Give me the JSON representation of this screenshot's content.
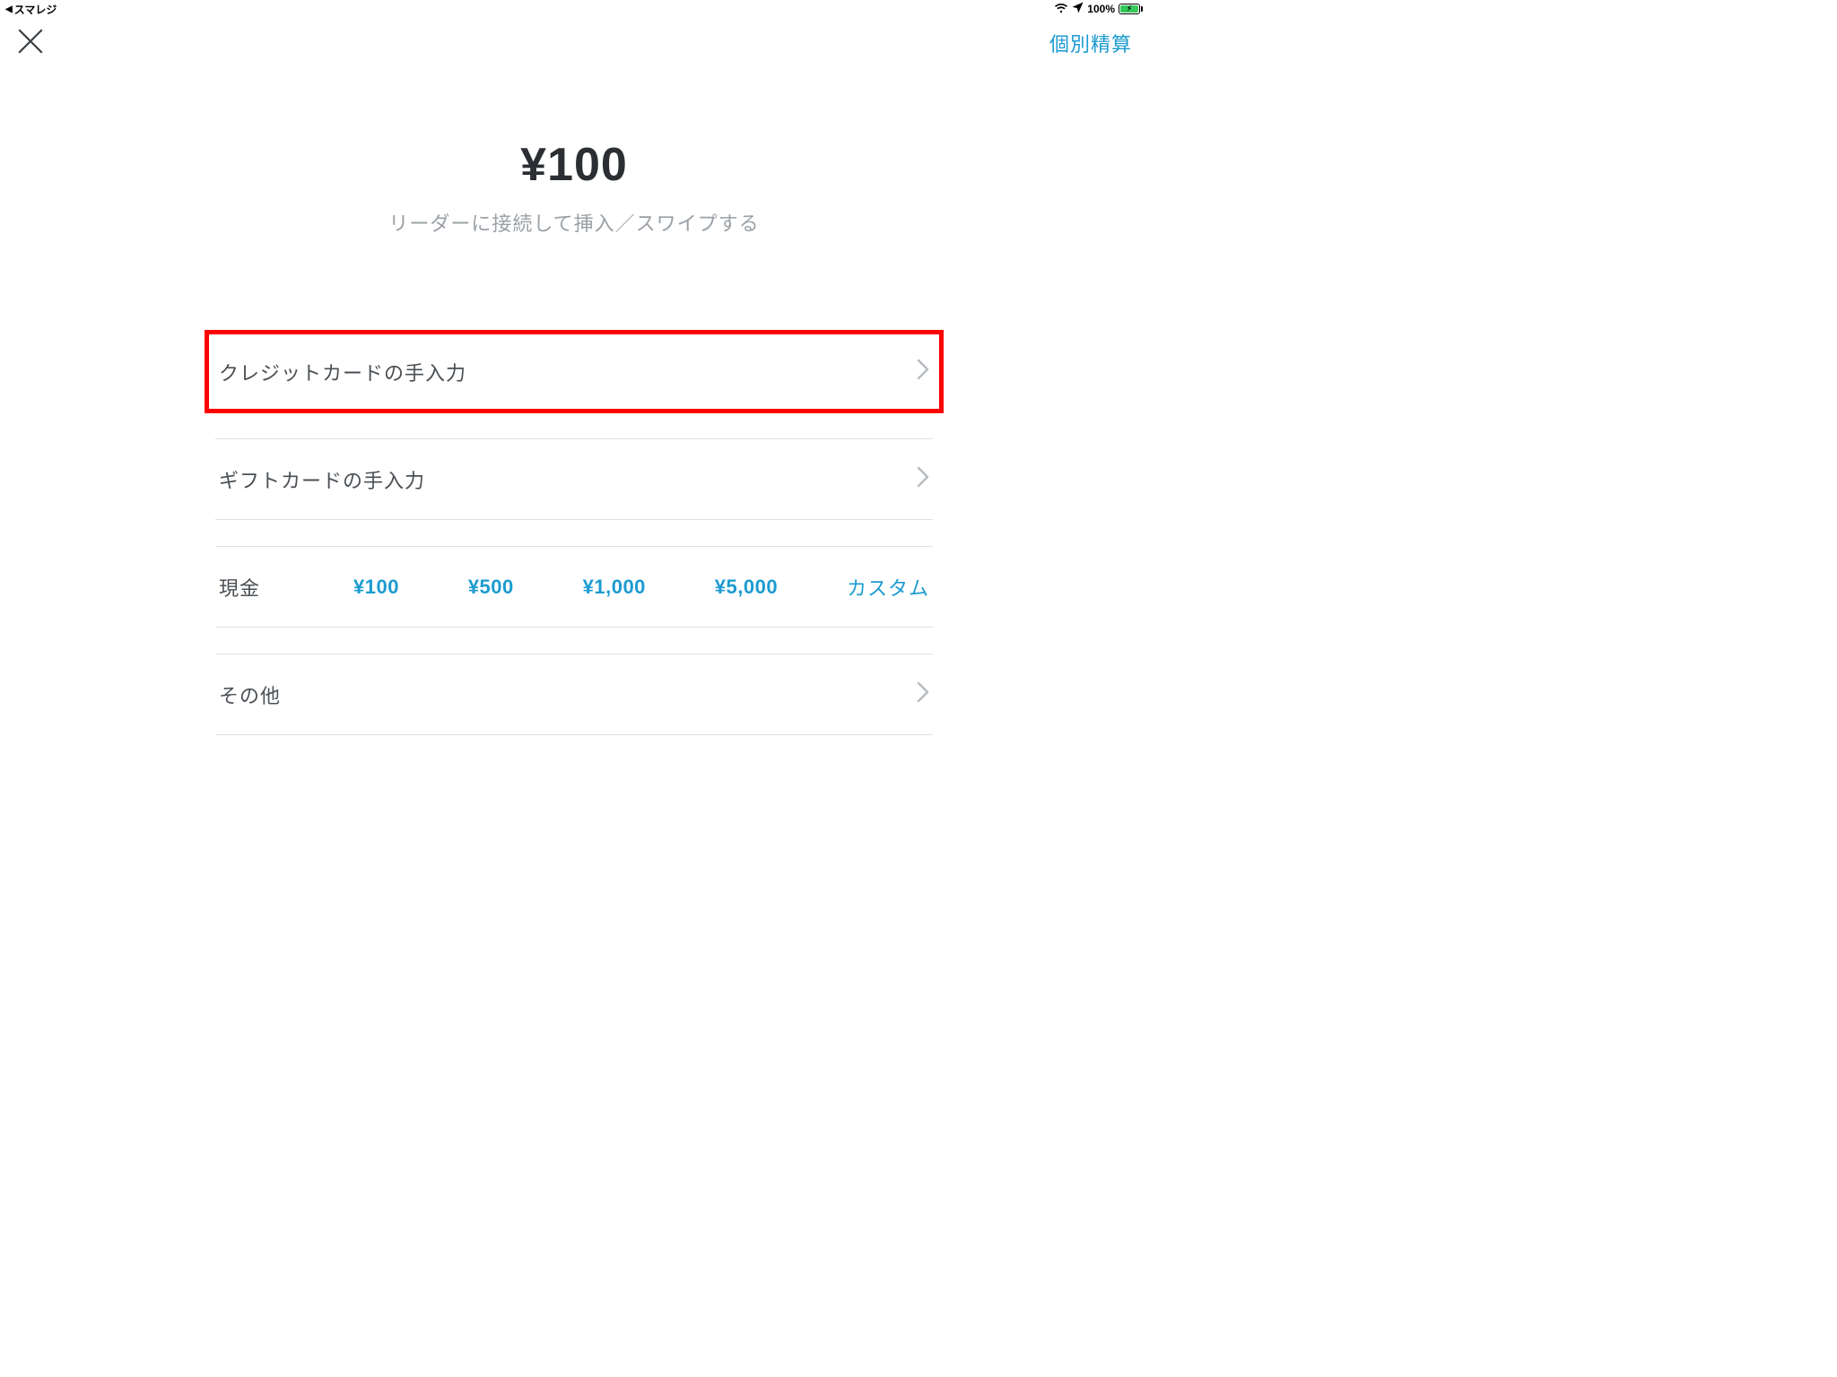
{
  "status_bar": {
    "back_app": "スマレジ",
    "battery_pct": "100%"
  },
  "nav": {
    "split_label": "個別精算"
  },
  "amount": "¥100",
  "subtitle": "リーダーに接続して挿入／スワイプする",
  "rows": {
    "credit_manual": "クレジットカードの手入力",
    "gift_manual": "ギフトカードの手入力",
    "other": "その他"
  },
  "cash": {
    "label": "現金",
    "opts": [
      "¥100",
      "¥500",
      "¥1,000",
      "¥5,000"
    ],
    "custom": "カスタム"
  }
}
